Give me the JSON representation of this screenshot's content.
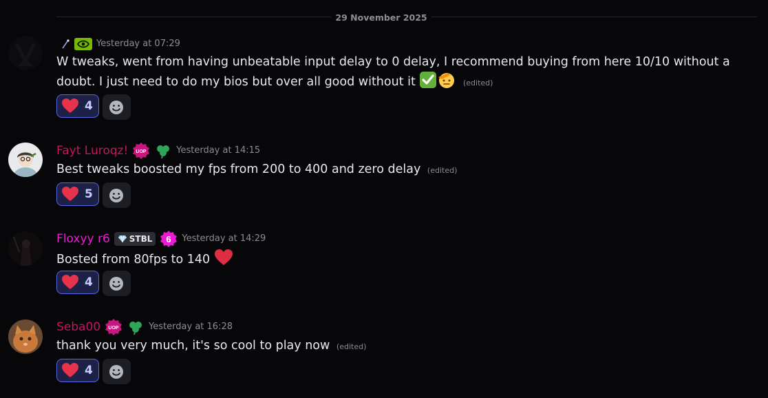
{
  "date_divider": "29 November 2025",
  "messages": [
    {
      "username": "",
      "timestamp": "Yesterday at 07:29",
      "content": "W tweaks, went from having unbeatable input delay to 0 delay, I recommend buying from here 10/10 without a doubt. I just need to do my bios but over all good without it",
      "edited": "(edited)",
      "reaction_emoji": "heart-icon",
      "reaction_count": "4"
    },
    {
      "username": "Fayt Luroqz!",
      "username_color": "#c0175f",
      "badge_text": "UOP",
      "timestamp": "Yesterday at 14:15",
      "content": "Best tweaks boosted my fps from 200 to 400 and zero delay",
      "edited": "(edited)",
      "reaction_emoji": "heart-icon",
      "reaction_count": "5"
    },
    {
      "username": "Floxyy r6",
      "username_color": "#e91ed5",
      "tag": "STBL",
      "badge_number": "6",
      "timestamp": "Yesterday at 14:29",
      "content": "Bosted from 80fps to 140",
      "reaction_emoji": "heart-icon",
      "reaction_count": "4"
    },
    {
      "username": "Seba00",
      "username_color": "#c0175f",
      "badge_text": "UOP",
      "timestamp": "Yesterday at 16:28",
      "content": "thank you very much, it's so cool to play now",
      "edited": "(edited)",
      "reaction_emoji": "heart-icon",
      "reaction_count": "4"
    }
  ],
  "colors": {
    "background": "#07070a",
    "text": "#e9e9ee",
    "muted": "#8b8d95",
    "reaction_border": "#5966e6",
    "reaction_bg": "#1d2147"
  }
}
